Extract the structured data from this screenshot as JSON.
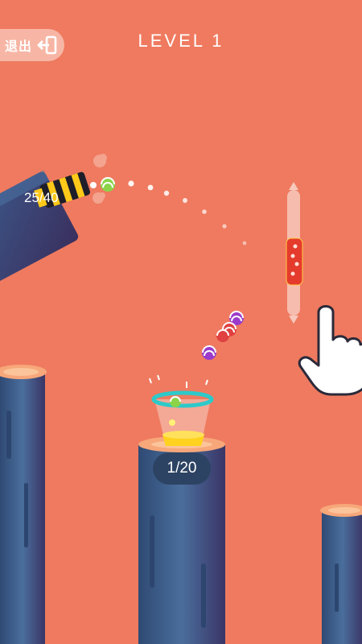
{
  "hud": {
    "exit_label": "退出",
    "level_label": "LEVEL",
    "level_number": "1",
    "level_text": "LEVEL  1",
    "ammo_counter": "25/40",
    "cup_progress": "1/20"
  },
  "icons": {
    "exit": "exit-door-arrow-icon",
    "hand": "pointing-hand-icon"
  },
  "colors": {
    "background": "#ef7a5f",
    "pillar": "#3d5a86",
    "pillar_top": "#f7a77a",
    "pill": "#2d4363",
    "cup_rim": "#2ec9c9",
    "liquid": "#ffd21f"
  }
}
